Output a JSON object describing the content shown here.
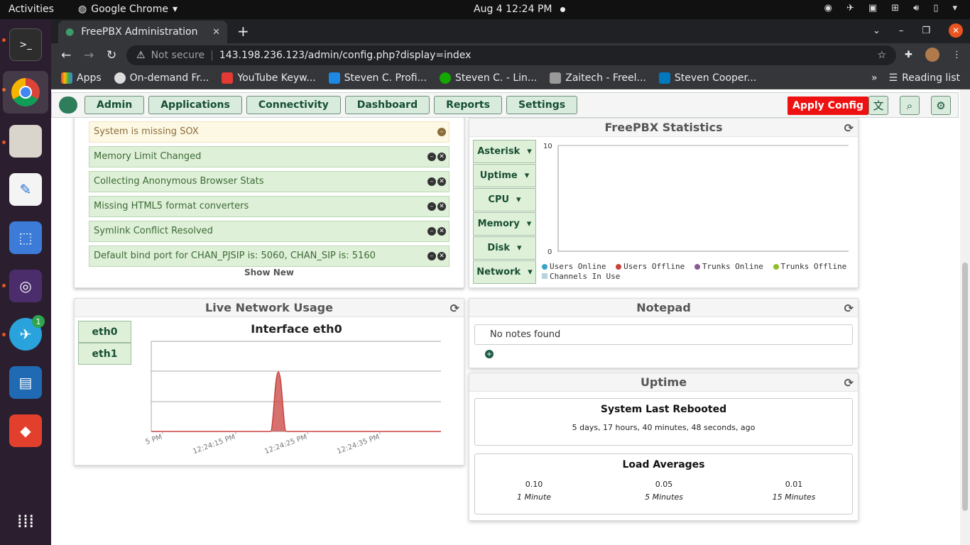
{
  "os": {
    "activities": "Activities",
    "app_menu": "Google Chrome",
    "clock": "Aug 4  12:24 PM",
    "telegram_badge": "1"
  },
  "browser": {
    "tab_title": "FreePBX Administration",
    "not_secure": "Not secure",
    "url": "143.198.236.123/admin/config.php?display=index",
    "bookmarks": [
      "Apps",
      "On-demand Fr...",
      "YouTube Keyw...",
      "Steven C. Profi...",
      "Steven C. - Lin...",
      "Zaitech - Freel...",
      "Steven Cooper..."
    ],
    "reading_list": "Reading list"
  },
  "nav": {
    "buttons": [
      "Admin",
      "Applications",
      "Connectivity",
      "Dashboard",
      "Reports",
      "Settings"
    ],
    "apply": "Apply Config"
  },
  "notices": {
    "items": [
      "System is missing SOX",
      "Memory Limit Changed",
      "Collecting Anonymous Browser Stats",
      "Missing HTML5 format converters",
      "Symlink Conflict Resolved",
      "Default bind port for CHAN_PJSIP is: 5060, CHAN_SIP is: 5160"
    ],
    "show_new": "Show New"
  },
  "stats": {
    "title": "FreePBX Statistics",
    "buttons": [
      "Asterisk",
      "Uptime",
      "CPU",
      "Memory",
      "Disk",
      "Network"
    ],
    "y_top": "10",
    "y_bottom": "0",
    "legend": [
      "Users Online",
      "Users Offline",
      "Trunks Online",
      "Trunks Offline",
      "Channels In Use"
    ]
  },
  "network": {
    "title": "Live Network Usage",
    "interfaces": [
      "eth0",
      "eth1"
    ],
    "chart_title": "Interface eth0",
    "x_labels": [
      "5 PM",
      "12:24:15 PM",
      "12:24:25 PM",
      "12:24:35 PM"
    ]
  },
  "notepad": {
    "title": "Notepad",
    "empty": "No notes found"
  },
  "uptime": {
    "title": "Uptime",
    "rebooted_title": "System Last Rebooted",
    "rebooted_value": "5 days, 17 hours, 40 minutes, 48 seconds, ago",
    "load_title": "Load Averages",
    "loads": [
      {
        "value": "0.10",
        "label": "1 Minute"
      },
      {
        "value": "0.05",
        "label": "5 Minutes"
      },
      {
        "value": "0.01",
        "label": "15 Minutes"
      }
    ]
  },
  "colors": {
    "users_online": "#3ba3c7",
    "users_offline": "#c9423e",
    "trunks_online": "#8a5a96",
    "trunks_offline": "#8fbf26",
    "channels": "#b7d3e0",
    "spike": "#c9423e"
  }
}
